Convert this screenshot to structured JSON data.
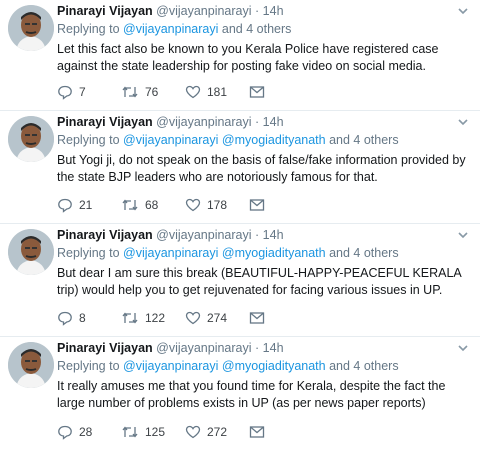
{
  "colors": {
    "accent": "#1b95e0",
    "muted": "#657786",
    "text": "#14171a"
  },
  "icons": {
    "reply": "reply-icon",
    "retweet": "retweet-icon",
    "like": "heart-icon",
    "dm": "envelope-icon",
    "more": "chevron-down-icon"
  },
  "tweets": [
    {
      "name": "Pinarayi Vijayan",
      "handle": "@vijayanpinarayi",
      "dot": "·",
      "time": "14h",
      "replying_prefix": "Replying to",
      "mention1": "@vijayanpinarayi",
      "mention2": "",
      "others": "and 4 others",
      "text": "Let this fact also be known to you Kerala Police have registered case against the state leadership for posting fake video on social media.",
      "replies": "7",
      "retweets": "76",
      "likes": "181"
    },
    {
      "name": "Pinarayi Vijayan",
      "handle": "@vijayanpinarayi",
      "dot": "·",
      "time": "14h",
      "replying_prefix": "Replying to",
      "mention1": "@vijayanpinarayi",
      "mention2": "@myogiadityanath",
      "others": "and 4 others",
      "text": "But Yogi ji, do not speak on the basis of false/fake information provided by the state BJP leaders who are notoriously famous for that.",
      "replies": "21",
      "retweets": "68",
      "likes": "178"
    },
    {
      "name": "Pinarayi Vijayan",
      "handle": "@vijayanpinarayi",
      "dot": "·",
      "time": "14h",
      "replying_prefix": "Replying to",
      "mention1": "@vijayanpinarayi",
      "mention2": "@myogiadityanath",
      "others": "and 4 others",
      "text": "But dear I am sure this break (BEAUTIFUL-HAPPY-PEACEFUL KERALA trip) would help you to get rejuvenated for facing various issues  in UP.",
      "replies": "8",
      "retweets": "122",
      "likes": "274"
    },
    {
      "name": "Pinarayi Vijayan",
      "handle": "@vijayanpinarayi",
      "dot": "·",
      "time": "14h",
      "replying_prefix": "Replying to",
      "mention1": "@vijayanpinarayi",
      "mention2": "@myogiadityanath",
      "others": "and 4 others",
      "text": "It really amuses me that you found time for Kerala, despite the fact the large number of problems exists in UP (as per news paper reports)",
      "replies": "28",
      "retweets": "125",
      "likes": "272"
    }
  ]
}
